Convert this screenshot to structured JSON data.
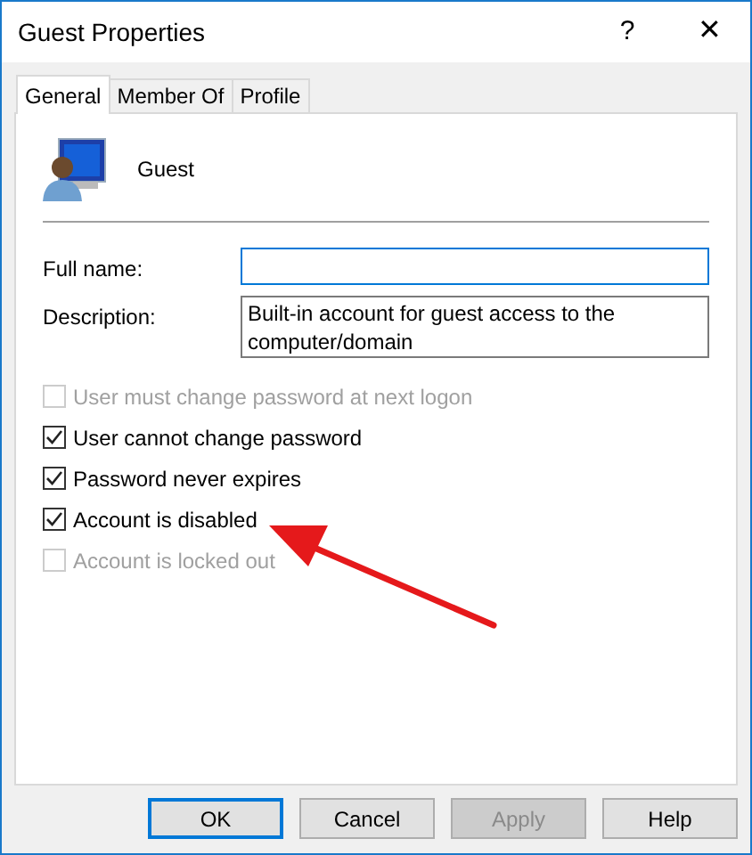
{
  "window": {
    "title": "Guest Properties",
    "help": "?",
    "close": "✕"
  },
  "tabs": [
    {
      "label": "General",
      "selected": true
    },
    {
      "label": "Member Of",
      "selected": false
    },
    {
      "label": "Profile",
      "selected": false
    }
  ],
  "user": {
    "name": "Guest"
  },
  "fields": [
    {
      "label": "Full name:",
      "focused": true
    },
    {
      "label": "Description:",
      "value": "Built-in account for guest access to the computer/domain",
      "focused": false
    }
  ],
  "options": [
    {
      "label": "User must change password at next logon",
      "checked": false,
      "disabled": true
    },
    {
      "label": "User cannot change password",
      "checked": true,
      "disabled": false
    },
    {
      "label": "Password never expires",
      "checked": true,
      "disabled": false
    },
    {
      "label": "Account is disabled",
      "checked": true,
      "disabled": false
    },
    {
      "label": "Account is locked out",
      "checked": false,
      "disabled": true
    }
  ],
  "annotation": {
    "kind": "arrow"
  },
  "buttons": [
    {
      "label": "OK",
      "default": true,
      "disabled": false
    },
    {
      "label": "Cancel",
      "default": false,
      "disabled": false
    },
    {
      "label": "Apply",
      "default": false,
      "disabled": true
    },
    {
      "label": "Help",
      "default": false,
      "disabled": false
    }
  ]
}
